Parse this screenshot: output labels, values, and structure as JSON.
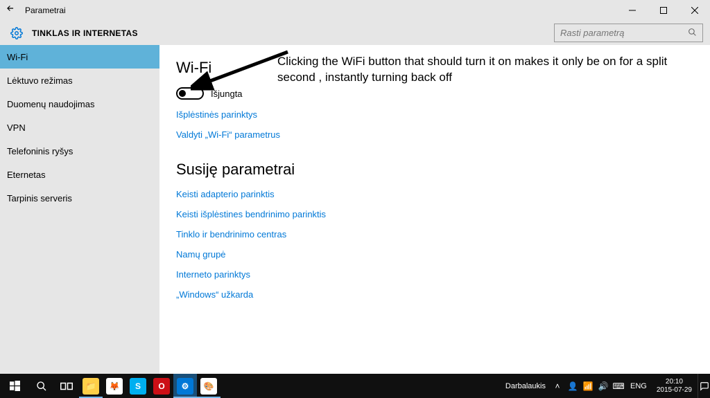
{
  "titlebar": {
    "app_name": "Parametrai"
  },
  "header": {
    "heading": "TINKLAS IR INTERNETAS",
    "search_placeholder": "Rasti parametrą"
  },
  "sidebar": {
    "items": [
      {
        "label": "Wi-Fi",
        "active": true
      },
      {
        "label": "Lėktuvo režimas",
        "active": false
      },
      {
        "label": "Duomenų naudojimas",
        "active": false
      },
      {
        "label": "VPN",
        "active": false
      },
      {
        "label": "Telefoninis ryšys",
        "active": false
      },
      {
        "label": "Eternetas",
        "active": false
      },
      {
        "label": "Tarpinis serveris",
        "active": false
      }
    ]
  },
  "content": {
    "wifi_heading": "Wi-Fi",
    "toggle_state": "Išjungta",
    "links_top": [
      "Išplėstinės parinktys",
      "Valdyti „Wi-Fi“ parametrus"
    ],
    "related_heading": "Susiję parametrai",
    "links_related": [
      "Keisti adapterio parinktis",
      "Keisti išplėstines bendrinimo parinktis",
      "Tinklo ir bendrinimo centras",
      "Namų grupė",
      "Interneto parinktys",
      "„Windows“ užkarda"
    ]
  },
  "annotation": {
    "text": "Clicking the WiFi button that should turn it on makes it only be on for a split second , instantly turning back off"
  },
  "taskbar": {
    "desktop_label": "Darbalaukis",
    "lang": "ENG",
    "time": "20:10",
    "date": "2015-07-29"
  }
}
